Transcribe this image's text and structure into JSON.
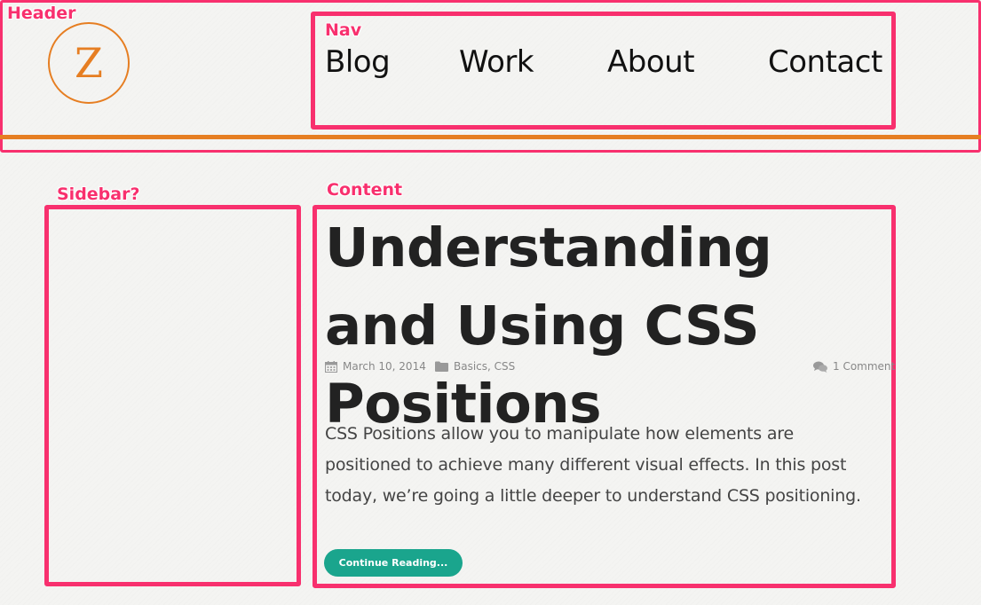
{
  "annotations": {
    "header": "Header",
    "nav": "Nav",
    "sidebar": "Sidebar?",
    "content": "Content"
  },
  "header": {
    "logo_letter": "Z",
    "accent_color": "#e67e22"
  },
  "nav": {
    "items": [
      {
        "label": "Blog"
      },
      {
        "label": "Work"
      },
      {
        "label": "About"
      },
      {
        "label": "Contact"
      }
    ]
  },
  "post": {
    "title": "Understanding and Using CSS Positions",
    "date": "March 10, 2014",
    "categories": "Basics, CSS",
    "comments": "1 Comment",
    "excerpt": "CSS Positions allow you to manipulate how elements are positioned to achieve many different visual effects. In this post today, we’re going a little deeper to understand CSS positioning.",
    "cta_label": "Continue Reading...",
    "cta_color": "#1aa58d"
  },
  "icons": {
    "date": "calendar-icon",
    "categories": "folder-icon",
    "comments": "comments-icon"
  },
  "annotation_color": "#f8306e"
}
